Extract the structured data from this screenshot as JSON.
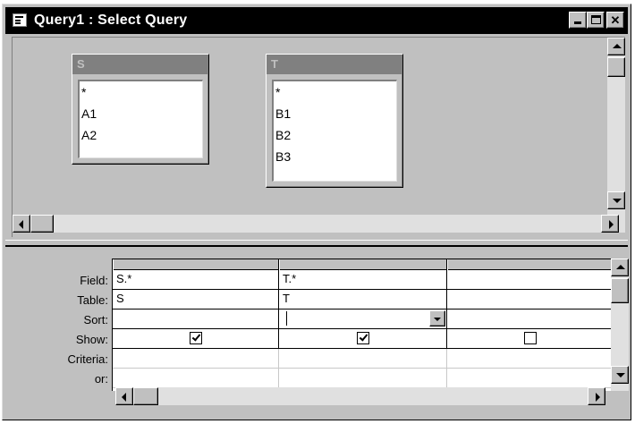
{
  "window": {
    "title": "Query1 : Select Query",
    "icon": "query-icon",
    "controls": [
      "minimize-icon",
      "maximize-icon",
      "close-icon"
    ]
  },
  "tables": [
    {
      "name": "S",
      "fields": [
        "*",
        "A1",
        "A2"
      ]
    },
    {
      "name": "T",
      "fields": [
        "*",
        "B1",
        "B2",
        "B3"
      ]
    }
  ],
  "grid": {
    "row_labels": [
      "Field:",
      "Table:",
      "Sort:",
      "Show:",
      "Criteria:",
      "or:"
    ],
    "columns": [
      {
        "field": "S.*",
        "table": "S",
        "sort": "",
        "show": true,
        "criteria": "",
        "or": ""
      },
      {
        "field": "T.*",
        "table": "T",
        "sort": "",
        "show": true,
        "criteria": "",
        "or": "",
        "sort_dropdown": true
      },
      {
        "field": "",
        "table": "",
        "sort": "",
        "show": false,
        "criteria": "",
        "or": ""
      }
    ]
  },
  "colors": {
    "title_bar": "#000000",
    "face": "#c0c0c0",
    "inactive_header": "#808080"
  }
}
